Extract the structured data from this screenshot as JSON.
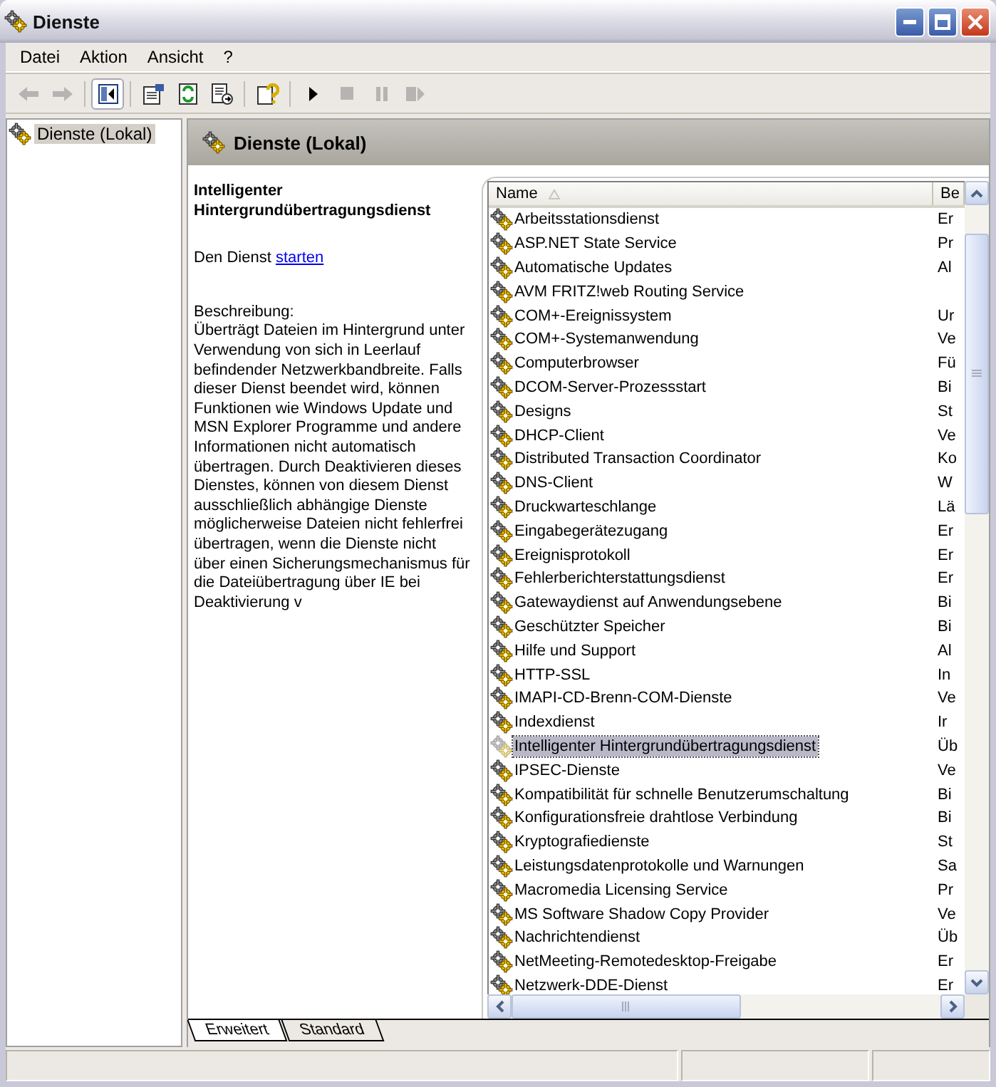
{
  "window": {
    "title": "Dienste"
  },
  "menu": [
    {
      "label": "Datei"
    },
    {
      "label": "Aktion"
    },
    {
      "label": "Ansicht"
    },
    {
      "label": "?"
    }
  ],
  "toolbar": [
    {
      "kind": "back",
      "disabled": true,
      "pressed": false
    },
    {
      "kind": "forward",
      "disabled": true,
      "pressed": false
    },
    {
      "kind": "tree-toggle",
      "disabled": false,
      "pressed": true
    },
    {
      "kind": "properties",
      "disabled": false,
      "pressed": false
    },
    {
      "kind": "refresh",
      "disabled": false,
      "pressed": false
    },
    {
      "kind": "export",
      "disabled": false,
      "pressed": false
    },
    {
      "kind": "help",
      "disabled": false,
      "pressed": false
    },
    {
      "kind": "start",
      "disabled": false,
      "pressed": false
    },
    {
      "kind": "stop",
      "disabled": true,
      "pressed": false
    },
    {
      "kind": "pause",
      "disabled": true,
      "pressed": false
    },
    {
      "kind": "restart",
      "disabled": true,
      "pressed": false
    }
  ],
  "tree": [
    {
      "label": "Dienste (Lokal)",
      "selected": true
    }
  ],
  "header": {
    "title": "Dienste (Lokal)"
  },
  "details": {
    "service_name": "Intelligenter Hintergrundübertragungsdienst",
    "action_prefix": "Den Dienst",
    "action_link": "starten",
    "description_label": "Beschreibung:",
    "description": "Überträgt Dateien im Hintergrund unter Verwendung von sich in Leerlauf befindender Netzwerkbandbreite. Falls dieser Dienst beendet wird, können Funktionen wie Windows Update und MSN Explorer Programme und andere Informationen nicht automatisch übertragen. Durch Deaktivieren dieses Dienstes, können von diesem Dienst ausschließlich abhängige Dienste möglicherweise Dateien nicht fehlerfrei übertragen, wenn die Dienste nicht über einen Sicherungsmechanismus für die Dateiübertragung über IE bei Deaktivierung v"
  },
  "table": {
    "columns": [
      "Name",
      "Be"
    ],
    "rows": [
      {
        "name": "Arbeitsstationsdienst",
        "column_2": "Er",
        "selected": false
      },
      {
        "name": "ASP.NET State Service",
        "column_2": "Pr",
        "selected": false
      },
      {
        "name": "Automatische Updates",
        "column_2": "Al",
        "selected": false
      },
      {
        "name": "AVM FRITZ!web Routing Service",
        "selected": false
      },
      {
        "name": "COM+-Ereignissystem",
        "column_2": "Ur",
        "selected": false
      },
      {
        "name": "COM+-Systemanwendung",
        "column_2": "Ve",
        "selected": false
      },
      {
        "name": "Computerbrowser",
        "column_2": "Fü",
        "selected": false
      },
      {
        "name": "DCOM-Server-Prozessstart",
        "column_2": "Bi",
        "selected": false
      },
      {
        "name": "Designs",
        "column_2": "St",
        "selected": false
      },
      {
        "name": "DHCP-Client",
        "column_2": "Ve",
        "selected": false
      },
      {
        "name": "Distributed Transaction Coordinator",
        "column_2": "Ko",
        "selected": false
      },
      {
        "name": "DNS-Client",
        "column_2": "W",
        "selected": false
      },
      {
        "name": "Druckwarteschlange",
        "column_2": "Lä",
        "selected": false
      },
      {
        "name": "Eingabegerätezugang",
        "column_2": "Er",
        "selected": false
      },
      {
        "name": "Ereignisprotokoll",
        "column_2": "Er",
        "selected": false
      },
      {
        "name": "Fehlerberichterstattungsdienst",
        "column_2": "Er",
        "selected": false
      },
      {
        "name": "Gatewaydienst auf Anwendungsebene",
        "column_2": "Bi",
        "selected": false
      },
      {
        "name": "Geschützter Speicher",
        "column_2": "Bi",
        "selected": false
      },
      {
        "name": "Hilfe und Support",
        "column_2": "Al",
        "selected": false
      },
      {
        "name": "HTTP-SSL",
        "column_2": "In",
        "selected": false
      },
      {
        "name": "IMAPI-CD-Brenn-COM-Dienste",
        "column_2": "Ve",
        "selected": false
      },
      {
        "name": "Indexdienst",
        "column_2": "Ir",
        "selected": false
      },
      {
        "name": "Intelligenter Hintergrundübertragungsdienst",
        "column_2": "Üb",
        "selected": true
      },
      {
        "name": "IPSEC-Dienste",
        "column_2": "Ve",
        "selected": false
      },
      {
        "name": "Kompatibilität für schnelle Benutzerumschaltung",
        "column_2": "Bi",
        "selected": false
      },
      {
        "name": "Konfigurationsfreie drahtlose Verbindung",
        "column_2": "Bi",
        "selected": false
      },
      {
        "name": "Kryptografiedienste",
        "column_2": "St",
        "selected": false
      },
      {
        "name": "Leistungsdatenprotokolle und Warnungen",
        "column_2": "Sa",
        "selected": false
      },
      {
        "name": "Macromedia Licensing Service",
        "column_2": "Pr",
        "selected": false
      },
      {
        "name": "MS Software Shadow Copy Provider",
        "column_2": "Ve",
        "selected": false
      },
      {
        "name": "Nachrichtendienst",
        "column_2": "Üb",
        "selected": false
      },
      {
        "name": "NetMeeting-Remotedesktop-Freigabe",
        "column_2": "Er",
        "selected": false
      },
      {
        "name": "Netzwerk-DDE-Dienst",
        "column_2": "Er",
        "selected": false
      }
    ]
  },
  "tabs": [
    {
      "label": "Erweitert",
      "selected": true
    },
    {
      "label": "Standard",
      "selected": false
    }
  ]
}
